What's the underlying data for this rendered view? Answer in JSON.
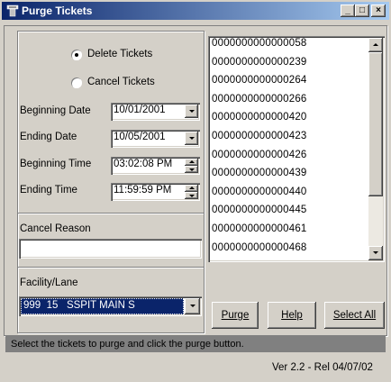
{
  "window": {
    "title": "Purge Tickets",
    "min_label": "_",
    "max_label": "□",
    "close_label": "×"
  },
  "options": {
    "delete_label": "Delete Tickets",
    "cancel_label": "Cancel Tickets",
    "selected": "delete"
  },
  "dates": {
    "begin_date_label": "Beginning Date",
    "begin_date_value": "10/01/2001",
    "end_date_label": "Ending Date",
    "end_date_value": "10/05/2001",
    "begin_time_label": "Beginning Time",
    "begin_time_value": "03:02:08 PM",
    "end_time_label": "Ending Time",
    "end_time_value": "11:59:59 PM"
  },
  "cancel_reason": {
    "label": "Cancel Reason",
    "value": ""
  },
  "facility": {
    "label": "Facility/Lane",
    "selected": "999  15   SSPIT MAIN S"
  },
  "tickets": [
    "0000000000000058",
    "0000000000000239",
    "0000000000000264",
    "0000000000000266",
    "0000000000000420",
    "0000000000000423",
    "0000000000000426",
    "0000000000000439",
    "0000000000000440",
    "0000000000000445",
    "0000000000000461",
    "0000000000000468"
  ],
  "buttons": {
    "purge": "Purge",
    "help": "Help",
    "select_all": "Select All"
  },
  "status": {
    "message": "Select the tickets to purge and click the purge button.",
    "version": "Ver 2.2 - Rel 04/07/02"
  }
}
